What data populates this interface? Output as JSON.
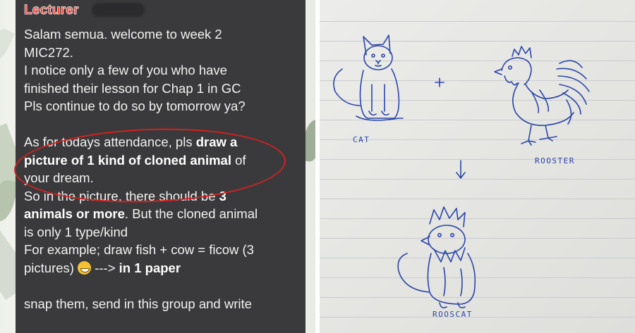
{
  "chat": {
    "sender": "Lecturer",
    "lines": {
      "l1": "Salam semua. welcome to week 2",
      "l2": "MIC272.",
      "l3": "I notice only a few of you who have",
      "l4": "finished their lesson for Chap 1 in GC",
      "l5": "Pls continue to do so by tomorrow ya?",
      "l6_a": "As for todays attendance, pls ",
      "l6_b": "draw a",
      "l7_a": "picture of 1 kind of cloned animal",
      "l7_b": " of",
      "l8": "your dream.",
      "l9_a": "So in the picture, there should be ",
      "l9_b": "3",
      "l10_a": "animals or more",
      "l10_b": ". But the cloned animal",
      "l11": "is only 1 type/kind",
      "l12": "For example; draw fish + cow = ficow (3",
      "l13_a": "pictures) ",
      "l13_b": " ---> ",
      "l13_c": "in 1 paper",
      "l14": "snap them, send in this group and write"
    },
    "emoji": "grinning-face-emoji",
    "highlight_color": "#d62020",
    "accent_color": "#ff3b30"
  },
  "drawing": {
    "label_cat": "CAT",
    "label_rooster": "ROOSTER",
    "label_result": "ROOSCAT",
    "plus": "+",
    "arrow": "↓",
    "ink_color": "#2a46a8"
  }
}
